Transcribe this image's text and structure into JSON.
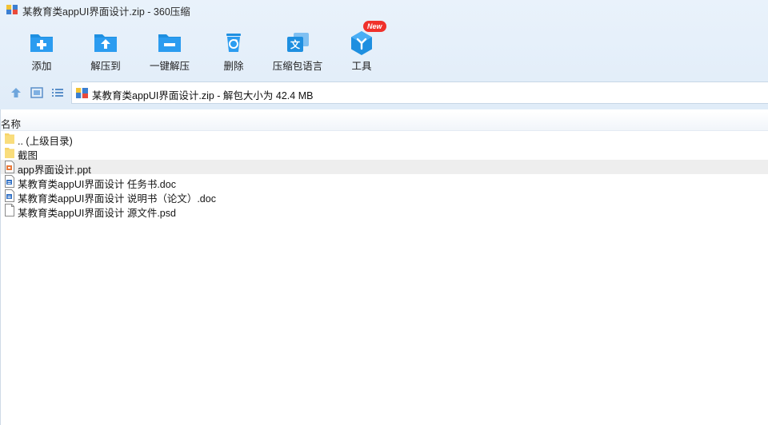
{
  "window": {
    "title": "某教育类appUI界面设计.zip - 360压缩"
  },
  "toolbar": {
    "items": [
      {
        "label": "添加",
        "icon": "add-file-icon"
      },
      {
        "label": "解压到",
        "icon": "extract-to-icon"
      },
      {
        "label": "一键解压",
        "icon": "one-click-extract-icon"
      },
      {
        "label": "删除",
        "icon": "recycle-delete-icon"
      },
      {
        "label": "压缩包语言",
        "icon": "language-icon"
      },
      {
        "label": "工具",
        "icon": "tools-cube-icon"
      }
    ],
    "new_badge": "New"
  },
  "navbar": {
    "address": "某教育类appUI界面设计.zip - 解包大小为 42.4 MB"
  },
  "file_list": {
    "column_name": "名称",
    "rows": [
      {
        "name": ".. (上级目录)",
        "icon": "folder-icon"
      },
      {
        "name": "截图",
        "icon": "folder-icon"
      },
      {
        "name": "app界面设计.ppt",
        "icon": "ppt-file-icon",
        "selected": true
      },
      {
        "name": "某教育类appUI界面设计 任务书.doc",
        "icon": "doc-file-icon"
      },
      {
        "name": "某教育类appUI界面设计 说明书（论文）.doc",
        "icon": "doc-file-icon"
      },
      {
        "name": "某教育类appUI界面设计 源文件.psd",
        "icon": "generic-file-icon"
      }
    ]
  },
  "colors": {
    "accent_blue": "#1e8fe0",
    "header_bg": "#e6f0fa",
    "folder_yellow": "#f6d46a",
    "badge_red": "#f0312b"
  }
}
